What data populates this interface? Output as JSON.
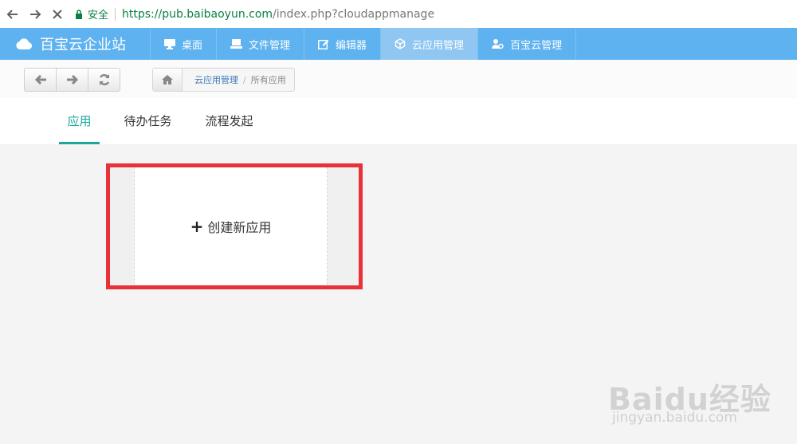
{
  "browser": {
    "secure_label": "安全",
    "url_main": "https://pub.baibaoyun.com",
    "url_rest": "/index.php?cloudappmanage"
  },
  "header": {
    "brand": "百宝云企业站",
    "nav": [
      {
        "label": "桌面",
        "icon": "monitor-icon"
      },
      {
        "label": "文件管理",
        "icon": "laptop-icon"
      },
      {
        "label": "编辑器",
        "icon": "edit-icon"
      },
      {
        "label": "云应用管理",
        "icon": "cube-icon",
        "active": true
      },
      {
        "label": "百宝云管理",
        "icon": "user-gear-icon"
      }
    ],
    "accent_color": "#5eb2ef"
  },
  "breadcrumb": {
    "link": "云应用管理",
    "separator": "/",
    "current": "所有应用"
  },
  "tabs": [
    {
      "label": "应用",
      "active": true
    },
    {
      "label": "待办任务"
    },
    {
      "label": "流程发起"
    }
  ],
  "create_card": {
    "plus": "+",
    "label": "创建新应用"
  },
  "watermark": {
    "main": "Baidu经验",
    "sub": "jingyan.baidu.com"
  },
  "colors": {
    "tab_active": "#1aa89a",
    "highlight": "#e8323a"
  }
}
